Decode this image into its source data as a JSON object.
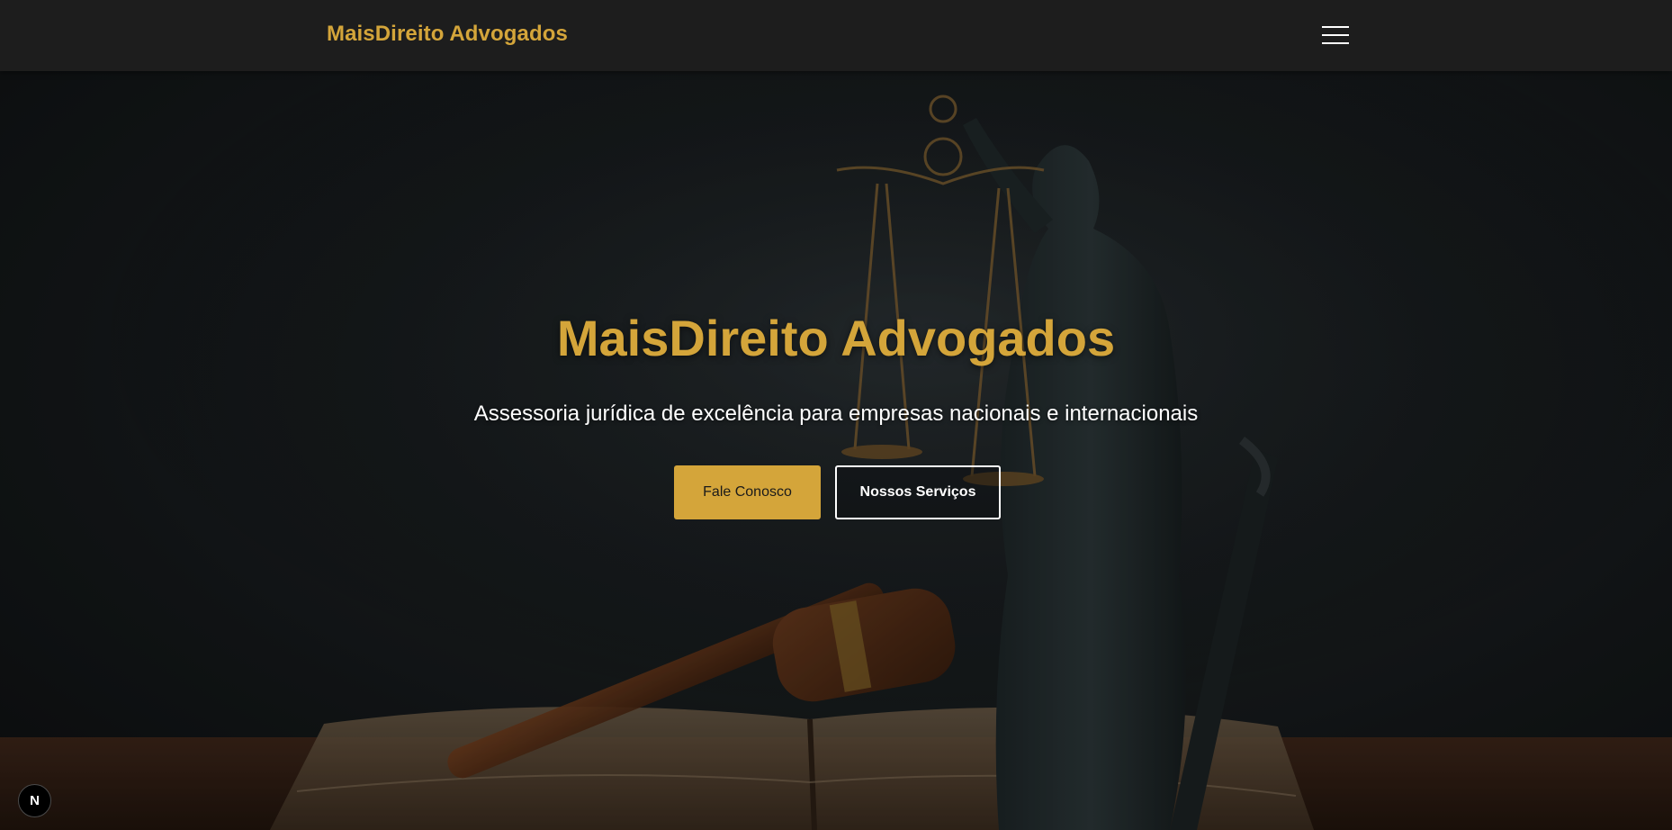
{
  "navbar": {
    "brand": "MaisDireito Advogados",
    "menu_icon": "hamburger-menu-icon"
  },
  "hero": {
    "background_image": "lady-justice-statue-gavel-book",
    "title": "MaisDireito Advogados",
    "subtitle": "Assessoria jurídica de excelência para empresas nacionais e internacionais",
    "primary_button": "Fale Conosco",
    "secondary_button": "Nossos Serviços"
  },
  "dev_badge": {
    "label": "N",
    "icon": "nextjs-logo-icon"
  },
  "colors": {
    "accent_gold": "#d4a53a",
    "navbar_bg": "#1d1d1d",
    "hero_bg": "#161a1c",
    "text_light": "#ffffff"
  }
}
